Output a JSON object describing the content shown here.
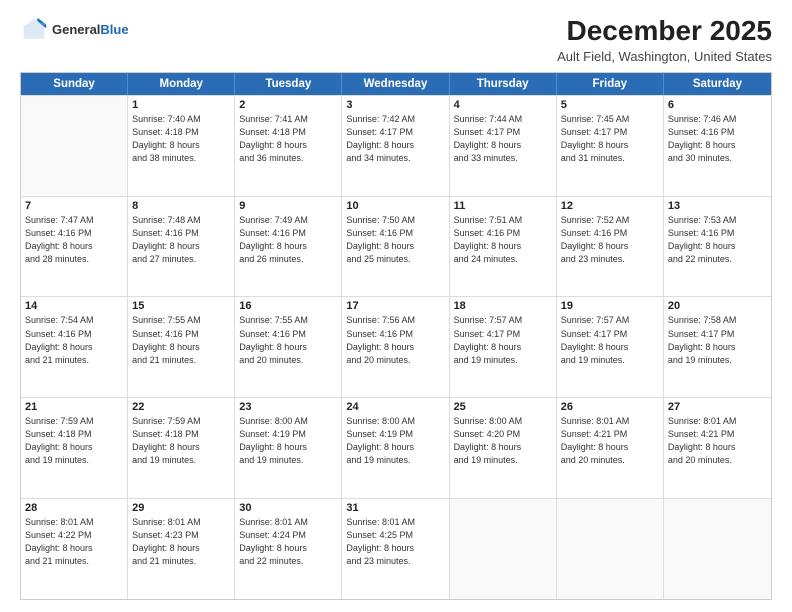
{
  "logo": {
    "general": "General",
    "blue": "Blue"
  },
  "title": "December 2025",
  "subtitle": "Ault Field, Washington, United States",
  "headers": [
    "Sunday",
    "Monday",
    "Tuesday",
    "Wednesday",
    "Thursday",
    "Friday",
    "Saturday"
  ],
  "rows": [
    [
      {
        "day": "",
        "lines": []
      },
      {
        "day": "1",
        "lines": [
          "Sunrise: 7:40 AM",
          "Sunset: 4:18 PM",
          "Daylight: 8 hours",
          "and 38 minutes."
        ]
      },
      {
        "day": "2",
        "lines": [
          "Sunrise: 7:41 AM",
          "Sunset: 4:18 PM",
          "Daylight: 8 hours",
          "and 36 minutes."
        ]
      },
      {
        "day": "3",
        "lines": [
          "Sunrise: 7:42 AM",
          "Sunset: 4:17 PM",
          "Daylight: 8 hours",
          "and 34 minutes."
        ]
      },
      {
        "day": "4",
        "lines": [
          "Sunrise: 7:44 AM",
          "Sunset: 4:17 PM",
          "Daylight: 8 hours",
          "and 33 minutes."
        ]
      },
      {
        "day": "5",
        "lines": [
          "Sunrise: 7:45 AM",
          "Sunset: 4:17 PM",
          "Daylight: 8 hours",
          "and 31 minutes."
        ]
      },
      {
        "day": "6",
        "lines": [
          "Sunrise: 7:46 AM",
          "Sunset: 4:16 PM",
          "Daylight: 8 hours",
          "and 30 minutes."
        ]
      }
    ],
    [
      {
        "day": "7",
        "lines": [
          "Sunrise: 7:47 AM",
          "Sunset: 4:16 PM",
          "Daylight: 8 hours",
          "and 28 minutes."
        ]
      },
      {
        "day": "8",
        "lines": [
          "Sunrise: 7:48 AM",
          "Sunset: 4:16 PM",
          "Daylight: 8 hours",
          "and 27 minutes."
        ]
      },
      {
        "day": "9",
        "lines": [
          "Sunrise: 7:49 AM",
          "Sunset: 4:16 PM",
          "Daylight: 8 hours",
          "and 26 minutes."
        ]
      },
      {
        "day": "10",
        "lines": [
          "Sunrise: 7:50 AM",
          "Sunset: 4:16 PM",
          "Daylight: 8 hours",
          "and 25 minutes."
        ]
      },
      {
        "day": "11",
        "lines": [
          "Sunrise: 7:51 AM",
          "Sunset: 4:16 PM",
          "Daylight: 8 hours",
          "and 24 minutes."
        ]
      },
      {
        "day": "12",
        "lines": [
          "Sunrise: 7:52 AM",
          "Sunset: 4:16 PM",
          "Daylight: 8 hours",
          "and 23 minutes."
        ]
      },
      {
        "day": "13",
        "lines": [
          "Sunrise: 7:53 AM",
          "Sunset: 4:16 PM",
          "Daylight: 8 hours",
          "and 22 minutes."
        ]
      }
    ],
    [
      {
        "day": "14",
        "lines": [
          "Sunrise: 7:54 AM",
          "Sunset: 4:16 PM",
          "Daylight: 8 hours",
          "and 21 minutes."
        ]
      },
      {
        "day": "15",
        "lines": [
          "Sunrise: 7:55 AM",
          "Sunset: 4:16 PM",
          "Daylight: 8 hours",
          "and 21 minutes."
        ]
      },
      {
        "day": "16",
        "lines": [
          "Sunrise: 7:55 AM",
          "Sunset: 4:16 PM",
          "Daylight: 8 hours",
          "and 20 minutes."
        ]
      },
      {
        "day": "17",
        "lines": [
          "Sunrise: 7:56 AM",
          "Sunset: 4:16 PM",
          "Daylight: 8 hours",
          "and 20 minutes."
        ]
      },
      {
        "day": "18",
        "lines": [
          "Sunrise: 7:57 AM",
          "Sunset: 4:17 PM",
          "Daylight: 8 hours",
          "and 19 minutes."
        ]
      },
      {
        "day": "19",
        "lines": [
          "Sunrise: 7:57 AM",
          "Sunset: 4:17 PM",
          "Daylight: 8 hours",
          "and 19 minutes."
        ]
      },
      {
        "day": "20",
        "lines": [
          "Sunrise: 7:58 AM",
          "Sunset: 4:17 PM",
          "Daylight: 8 hours",
          "and 19 minutes."
        ]
      }
    ],
    [
      {
        "day": "21",
        "lines": [
          "Sunrise: 7:59 AM",
          "Sunset: 4:18 PM",
          "Daylight: 8 hours",
          "and 19 minutes."
        ]
      },
      {
        "day": "22",
        "lines": [
          "Sunrise: 7:59 AM",
          "Sunset: 4:18 PM",
          "Daylight: 8 hours",
          "and 19 minutes."
        ]
      },
      {
        "day": "23",
        "lines": [
          "Sunrise: 8:00 AM",
          "Sunset: 4:19 PM",
          "Daylight: 8 hours",
          "and 19 minutes."
        ]
      },
      {
        "day": "24",
        "lines": [
          "Sunrise: 8:00 AM",
          "Sunset: 4:19 PM",
          "Daylight: 8 hours",
          "and 19 minutes."
        ]
      },
      {
        "day": "25",
        "lines": [
          "Sunrise: 8:00 AM",
          "Sunset: 4:20 PM",
          "Daylight: 8 hours",
          "and 19 minutes."
        ]
      },
      {
        "day": "26",
        "lines": [
          "Sunrise: 8:01 AM",
          "Sunset: 4:21 PM",
          "Daylight: 8 hours",
          "and 20 minutes."
        ]
      },
      {
        "day": "27",
        "lines": [
          "Sunrise: 8:01 AM",
          "Sunset: 4:21 PM",
          "Daylight: 8 hours",
          "and 20 minutes."
        ]
      }
    ],
    [
      {
        "day": "28",
        "lines": [
          "Sunrise: 8:01 AM",
          "Sunset: 4:22 PM",
          "Daylight: 8 hours",
          "and 21 minutes."
        ]
      },
      {
        "day": "29",
        "lines": [
          "Sunrise: 8:01 AM",
          "Sunset: 4:23 PM",
          "Daylight: 8 hours",
          "and 21 minutes."
        ]
      },
      {
        "day": "30",
        "lines": [
          "Sunrise: 8:01 AM",
          "Sunset: 4:24 PM",
          "Daylight: 8 hours",
          "and 22 minutes."
        ]
      },
      {
        "day": "31",
        "lines": [
          "Sunrise: 8:01 AM",
          "Sunset: 4:25 PM",
          "Daylight: 8 hours",
          "and 23 minutes."
        ]
      },
      {
        "day": "",
        "lines": []
      },
      {
        "day": "",
        "lines": []
      },
      {
        "day": "",
        "lines": []
      }
    ]
  ]
}
